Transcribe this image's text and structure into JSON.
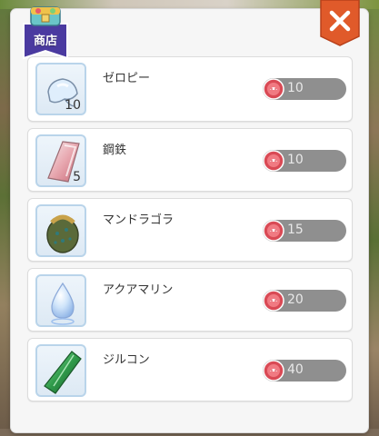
{
  "shop": {
    "title": "商店",
    "close_icon": "close-icon"
  },
  "items": [
    {
      "name": "ゼロピー",
      "quantity": "10",
      "price": "10",
      "icon": "zelopy-icon"
    },
    {
      "name": "鋼鉄",
      "quantity": "5",
      "price": "10",
      "icon": "steel-icon"
    },
    {
      "name": "マンドラゴラ",
      "quantity": "",
      "price": "15",
      "icon": "mandragora-icon"
    },
    {
      "name": "アクアマリン",
      "quantity": "",
      "price": "20",
      "icon": "aquamarine-icon"
    },
    {
      "name": "ジルコン",
      "quantity": "",
      "price": "40",
      "icon": "zircon-icon"
    }
  ],
  "colors": {
    "close_button": "#e05a2a",
    "badge": "#4a3aa0",
    "price_pill": "#8f8f8f",
    "coin": "#d94a55"
  }
}
